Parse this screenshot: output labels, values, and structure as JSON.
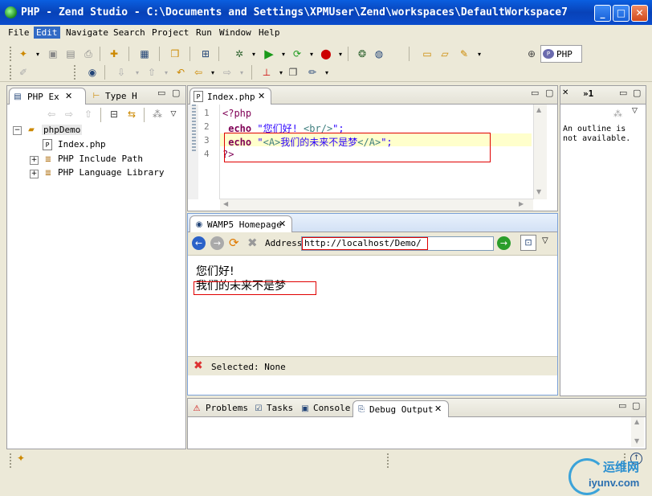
{
  "window": {
    "title": "PHP - Zend Studio - C:\\Documents and Settings\\XPMUser\\Zend\\workspaces\\DefaultWorkspace7",
    "min": "_",
    "max": "□",
    "close": "✕"
  },
  "menu": [
    "File",
    "Edit",
    "Navigate",
    "Search",
    "Project",
    "Run",
    "Window",
    "Help"
  ],
  "perspective": {
    "label": "PHP"
  },
  "left_panel": {
    "tabs": [
      {
        "label": "PHP Ex"
      },
      {
        "label": "Type H"
      }
    ],
    "tree": {
      "project": "phpDemo",
      "children": [
        {
          "label": "Index.php"
        },
        {
          "label": "PHP Include Path"
        },
        {
          "label": "PHP Language Library"
        }
      ]
    }
  },
  "editor": {
    "tab": "Index.php",
    "lines": [
      {
        "num": "1",
        "parts": [
          {
            "t": "<?php",
            "c": "#7f0055"
          }
        ]
      },
      {
        "num": "2",
        "parts": [
          {
            "t": " echo ",
            "c": "#7f0055",
            "b": true
          },
          {
            "t": "\"您们好! ",
            "c": "#2a00ff"
          },
          {
            "t": "<br/>",
            "c": "#3f7f7f"
          },
          {
            "t": "\";",
            "c": "#2a00ff"
          }
        ]
      },
      {
        "num": "3",
        "parts": [
          {
            "t": " echo ",
            "c": "#7f0055",
            "b": true
          },
          {
            "t": "\"",
            "c": "#2a00ff"
          },
          {
            "t": "<A>",
            "c": "#3f7f7f"
          },
          {
            "t": "我们的未来不是梦",
            "c": "#2a00ff"
          },
          {
            "t": "</A>",
            "c": "#3f7f7f"
          },
          {
            "t": "\";",
            "c": "#2a00ff"
          }
        ]
      },
      {
        "num": "4",
        "parts": [
          {
            "t": "?>",
            "c": "#7f0055"
          }
        ]
      }
    ]
  },
  "outline": {
    "tab": "»1",
    "text": "An outline is not available."
  },
  "browser": {
    "tab": "WAMP5 Homepage",
    "address_label": "Address",
    "url": "http://localhost/Demo/",
    "content_line1": "您们好!",
    "content_line2": "我们的未来不是梦",
    "status": "Selected: None"
  },
  "bottom": {
    "tabs": [
      {
        "label": "Problems"
      },
      {
        "label": "Tasks"
      },
      {
        "label": "Console"
      },
      {
        "label": "Debug Output"
      }
    ]
  },
  "watermark": {
    "text": "运维网",
    "sub": "iyunv.com"
  },
  "colors": {
    "titlebar": "#0a4ccc",
    "selection": "#316ac5",
    "highlight_line": "#ffffcc",
    "annotation": "#e00000"
  }
}
